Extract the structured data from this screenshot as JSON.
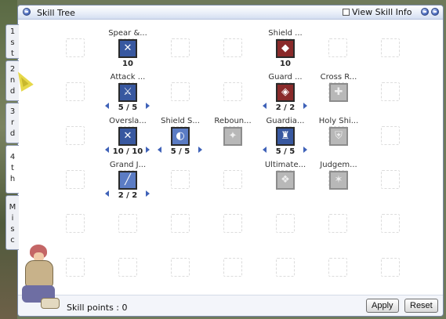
{
  "window": {
    "title": "Skill Tree",
    "view_info_label": "View Skill Info"
  },
  "tabs": [
    {
      "label": "1st",
      "chars": [
        "1",
        "s",
        "t"
      ],
      "active": false
    },
    {
      "label": "2nd",
      "chars": [
        "2",
        "n",
        "d"
      ],
      "active": false
    },
    {
      "label": "3rd",
      "chars": [
        "3",
        "r",
        "d"
      ],
      "active": false
    },
    {
      "label": "4th",
      "chars": [
        "4",
        "t",
        "h"
      ],
      "active": true
    },
    {
      "label": "Misc",
      "chars": [
        "M",
        "i",
        "s",
        "c"
      ],
      "active": false
    }
  ],
  "skills": [
    {
      "name": "Spear &...",
      "level": "10",
      "adjustable": false,
      "state": "learned",
      "icon": "spear-icon"
    },
    {
      "name": "Shield ...",
      "level": "10",
      "adjustable": false,
      "state": "learned",
      "icon": "shield-icon"
    },
    {
      "name": "Attack ...",
      "level": "5 / 5",
      "adjustable": true,
      "state": "learned",
      "icon": "attack-icon"
    },
    {
      "name": "Guard ...",
      "level": "2 / 2",
      "adjustable": true,
      "state": "learned",
      "icon": "guard-icon"
    },
    {
      "name": "Cross R...",
      "level": "",
      "adjustable": false,
      "state": "locked",
      "icon": "cross-icon"
    },
    {
      "name": "Oversla...",
      "level": "10 / 10",
      "adjustable": true,
      "state": "learned",
      "icon": "overslash-icon"
    },
    {
      "name": "Shield S...",
      "level": "5 / 5",
      "adjustable": true,
      "state": "learned",
      "icon": "shield-spell-icon"
    },
    {
      "name": "Reboun...",
      "level": "",
      "adjustable": false,
      "state": "locked",
      "icon": "rebound-icon"
    },
    {
      "name": "Guardia...",
      "level": "5 / 5",
      "adjustable": true,
      "state": "learned",
      "icon": "guardian-icon"
    },
    {
      "name": "Holy Shi...",
      "level": "",
      "adjustable": false,
      "state": "locked",
      "icon": "holy-shield-icon"
    },
    {
      "name": "Grand J...",
      "level": "2 / 2",
      "adjustable": true,
      "state": "learned",
      "icon": "grand-judgement-icon"
    },
    {
      "name": "Ultimate...",
      "level": "",
      "adjustable": false,
      "state": "locked",
      "icon": "ultimate-icon"
    },
    {
      "name": "Judgem...",
      "level": "",
      "adjustable": false,
      "state": "locked",
      "icon": "judgement-icon"
    }
  ],
  "footer": {
    "skill_points": "Skill points : 0",
    "apply_label": "Apply",
    "reset_label": "Reset"
  }
}
